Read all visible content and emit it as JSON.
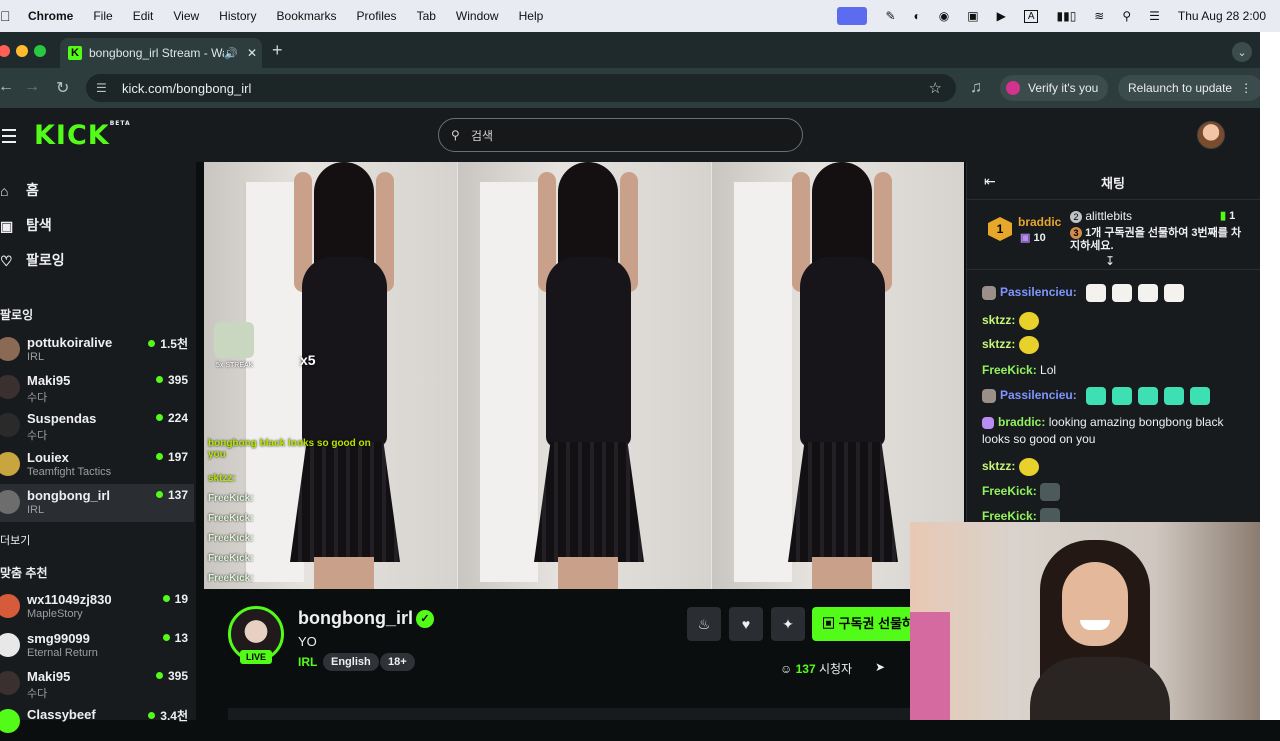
{
  "menubar": {
    "app": "Chrome",
    "items": [
      "File",
      "Edit",
      "View",
      "History",
      "Bookmarks",
      "Profiles",
      "Tab",
      "Window",
      "Help"
    ],
    "datetime": "Thu Aug 28  2:00",
    "input_indicator": "A"
  },
  "browser": {
    "tab_title": "bongbong_irl Stream - Wa",
    "url": "kick.com/bongbong_irl",
    "verify_label": "Verify it's you",
    "relaunch_label": "Relaunch to update",
    "accent": "#2d3d3e"
  },
  "kick": {
    "logo": "KICK",
    "logo_badge": "BETA",
    "search_placeholder": "검색",
    "brand_color": "#53fc18"
  },
  "sidebar": {
    "nav": [
      {
        "label": "홈",
        "icon": "home-icon"
      },
      {
        "label": "탐색",
        "icon": "browse-icon"
      },
      {
        "label": "팔로잉",
        "icon": "heart-icon"
      }
    ],
    "following_header": "팔로잉",
    "following": [
      {
        "name": "pottukoiralive",
        "category": "IRL",
        "viewers": "1.5천"
      },
      {
        "name": "Maki95",
        "category": "수다",
        "viewers": "395"
      },
      {
        "name": "Suspendas",
        "category": "수다",
        "viewers": "224"
      },
      {
        "name": "Louiex",
        "category": "Teamfight Tactics",
        "viewers": "197"
      },
      {
        "name": "bongbong_irl",
        "category": "IRL",
        "viewers": "137"
      }
    ],
    "show_more": "더보기",
    "recommended_header": "맞춤 추천",
    "recommended": [
      {
        "name": "wx11049zj830",
        "category": "MapleStory",
        "viewers": "19"
      },
      {
        "name": "smg99099",
        "category": "Eternal Return",
        "viewers": "13"
      },
      {
        "name": "Maki95",
        "category": "수다",
        "viewers": "395"
      },
      {
        "name": "Classybeef",
        "category": "",
        "viewers": "3.4천"
      }
    ]
  },
  "video_overlay": {
    "streak": "5x STREAK",
    "multiplier": "x5",
    "chat_lines": [
      {
        "user": "bongbong black looks so good on you",
        "text": ""
      },
      {
        "user": "sktzz:",
        "text": ""
      },
      {
        "user": "FreeKick:",
        "text": ""
      },
      {
        "user": "FreeKick:",
        "text": ""
      },
      {
        "user": "FreeKick:",
        "text": ""
      },
      {
        "user": "FreeKick:",
        "text": ""
      },
      {
        "user": "FreeKick:",
        "text": ""
      }
    ]
  },
  "channel": {
    "name": "bongbong_irl",
    "live": "LIVE",
    "title": "YO",
    "category": "IRL",
    "tags": [
      "English",
      "18+"
    ],
    "subscribe_label": "구독권 선물하기",
    "viewer_count": "137",
    "viewer_suffix": "시청자"
  },
  "chat": {
    "title": "채팅",
    "leaderboard": {
      "rank": "1",
      "top_user": "braddic",
      "top_count": "10",
      "second_user": "alittlebits",
      "second_count": "1",
      "gift_prompt": "1개 구독권을 선물하여 3번째를 차지하세요."
    },
    "messages": [
      {
        "user": "Passilencieu:",
        "text": "",
        "color": "#7f95ff"
      },
      {
        "user": "sktzz:",
        "text": "",
        "color": "#c7f57a"
      },
      {
        "user": "sktzz:",
        "text": "",
        "color": "#c7f57a"
      },
      {
        "user": "FreeKick:",
        "text": "Lol",
        "color": "#92f25c"
      },
      {
        "user": "Passilencieu:",
        "text": "",
        "color": "#7f95ff"
      },
      {
        "user": "braddic:",
        "text": "looking amazing bongbong black looks so good on you",
        "color": "#92f25c"
      },
      {
        "user": "sktzz:",
        "text": "",
        "color": "#c7f57a"
      },
      {
        "user": "FreeKick:",
        "text": "",
        "color": "#92f25c"
      },
      {
        "user": "FreeKick:",
        "text": "",
        "color": "#92f25c"
      }
    ]
  }
}
